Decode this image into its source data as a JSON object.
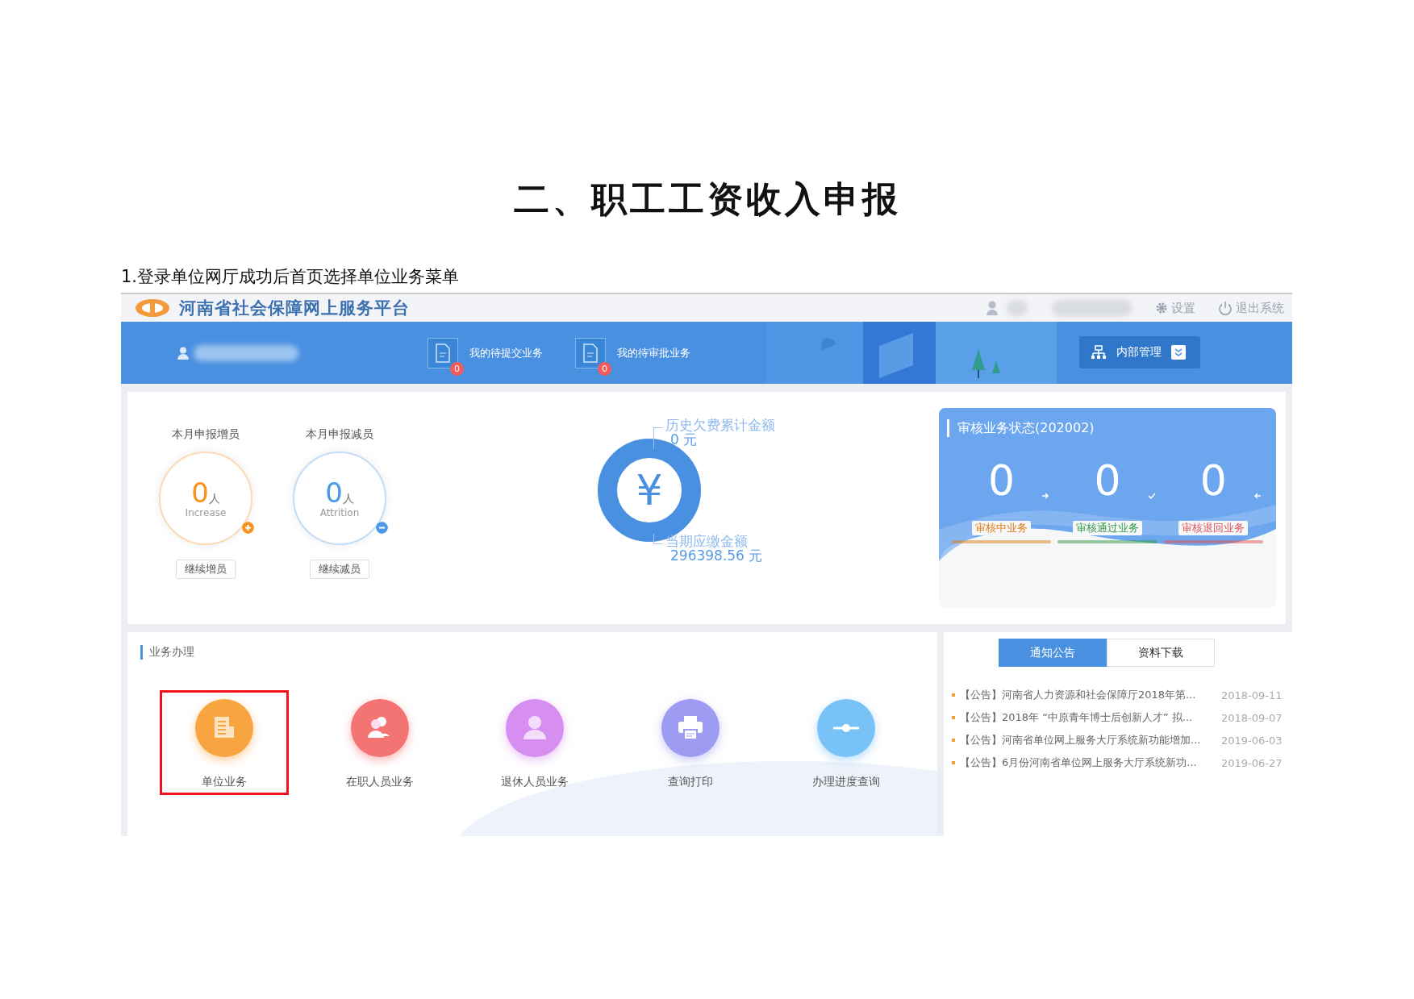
{
  "doc_title": "二、职工工资收入申报",
  "doc_step": "1.登录单位网厅成功后首页选择单位业务菜单",
  "app": {
    "site_title": "河南省社会保障网上服务平台",
    "top_links": [
      {
        "kind": "settings",
        "label": "设置"
      },
      {
        "kind": "logout",
        "label": "退出系统"
      }
    ],
    "tasks": [
      {
        "label": "我的待提交业务",
        "count": "0"
      },
      {
        "label": "我的待审批业务",
        "count": "0"
      }
    ],
    "admin_menu": {
      "label": "内部管理"
    },
    "counters": [
      {
        "kind": "increase",
        "title": "本月申报增员",
        "value": "0",
        "unit": "人",
        "caption": "Increase",
        "button": "继续增员"
      },
      {
        "kind": "attrition",
        "title": "本月申报减员",
        "value": "0",
        "unit": "人",
        "caption": "Attrition",
        "button": "继续减员"
      }
    ],
    "fees": {
      "symbol": "¥",
      "top_label": "历史欠费累计金额",
      "top_value": "0 元",
      "bottom_label": "当期应缴金额",
      "bottom_value": "296398.56 元"
    },
    "review": {
      "title": "审核业务状态(202002)",
      "items": [
        {
          "kind": "pending",
          "value": "0",
          "label": "审核中业务",
          "color": "#e07c16"
        },
        {
          "kind": "approved",
          "value": "0",
          "label": "审核通过业务",
          "color": "#2f9a45"
        },
        {
          "kind": "returned",
          "value": "0",
          "label": "审核退回业务",
          "color": "#e05555"
        }
      ]
    },
    "services": {
      "title": "业务办理",
      "items": [
        {
          "kind": "unit",
          "label": "单位业务",
          "color": "#f7a441",
          "selected": true
        },
        {
          "kind": "staff",
          "label": "在职人员业务",
          "color": "#f47474",
          "selected": false
        },
        {
          "kind": "retiree",
          "label": "退休人员业务",
          "color": "#d68ef0",
          "selected": false
        },
        {
          "kind": "print",
          "label": "查询打印",
          "color": "#9d9cf2",
          "selected": false
        },
        {
          "kind": "progress",
          "label": "办理进度查询",
          "color": "#79c2f7",
          "selected": false
        }
      ]
    },
    "notices": {
      "tabs": [
        {
          "label": "通知公告",
          "selected": true
        },
        {
          "label": "资料下载",
          "selected": false
        }
      ],
      "items": [
        {
          "text": "【公告】河南省人力资源和社会保障厅2018年第...",
          "date": "2018-09-11"
        },
        {
          "text": "【公告】2018年 “中原青年博士后创新人才” 拟...",
          "date": "2018-09-07"
        },
        {
          "text": "【公告】河南省单位网上服务大厅系统新功能增加...",
          "date": "2019-06-03"
        },
        {
          "text": "【公告】6月份河南省单位网上服务大厅系统新功...",
          "date": "2019-06-27"
        }
      ]
    }
  }
}
